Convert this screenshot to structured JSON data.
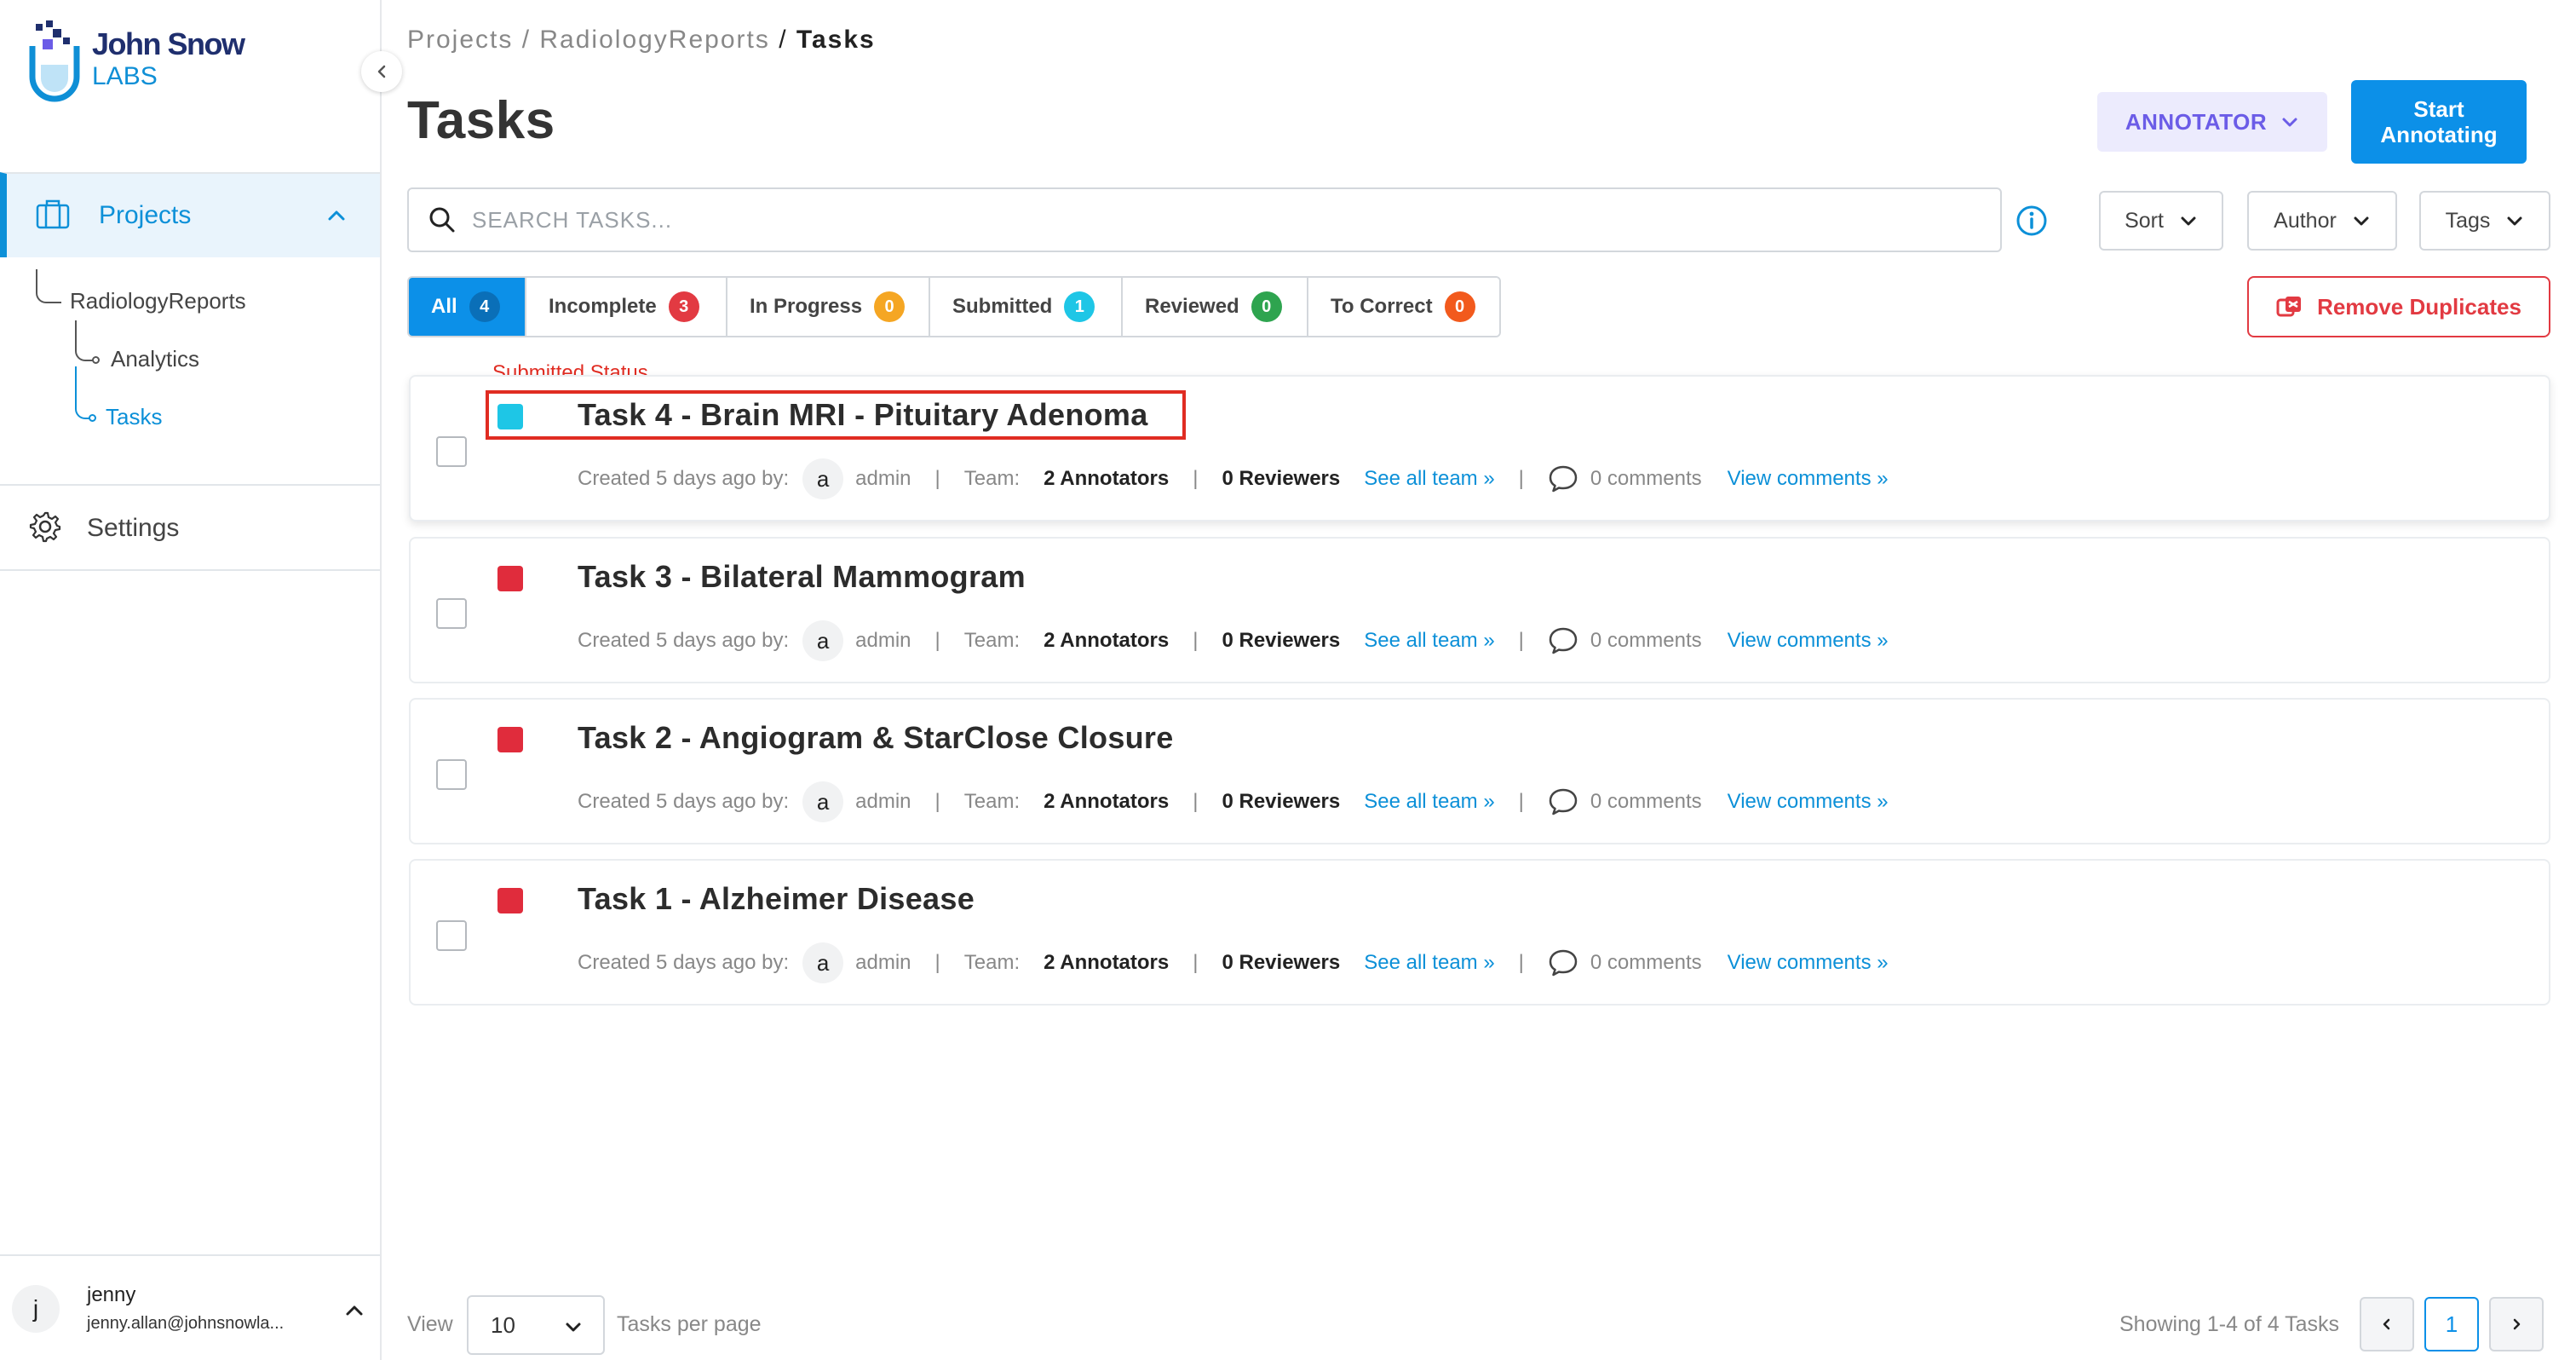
{
  "brand": {
    "name_line1": "John Snow",
    "name_line2": "LABS"
  },
  "sidebar": {
    "projects_label": "Projects",
    "tree": {
      "project": "RadiologyReports",
      "analytics": "Analytics",
      "tasks": "Tasks"
    },
    "settings_label": "Settings",
    "user": {
      "initial": "j",
      "name": "jenny",
      "email": "jenny.allan@johnsnowla..."
    }
  },
  "breadcrumb": {
    "item1": "Projects",
    "sep1": " / ",
    "item2": "RadiologyReports",
    "sep2": " / ",
    "current": "Tasks"
  },
  "page_title": "Tasks",
  "header": {
    "role_label": "ANNOTATOR",
    "start_line1": "Start",
    "start_line2": "Annotating"
  },
  "search": {
    "placeholder": "SEARCH TASKS..."
  },
  "filters": {
    "sort": "Sort",
    "author": "Author",
    "tags": "Tags"
  },
  "tabs": [
    {
      "label": "All",
      "count": "4",
      "color": "#0c90e8"
    },
    {
      "label": "Incomplete",
      "count": "3",
      "color": "#e23a42"
    },
    {
      "label": "In Progress",
      "count": "0",
      "color": "#f5a623"
    },
    {
      "label": "Submitted",
      "count": "1",
      "color": "#1ec6e6"
    },
    {
      "label": "Reviewed",
      "count": "0",
      "color": "#2ea44f"
    },
    {
      "label": "To Correct",
      "count": "0",
      "color": "#f25a1d"
    }
  ],
  "remove_duplicates": "Remove Duplicates",
  "annotation": {
    "label": "Submitted Status"
  },
  "meta_labels": {
    "created": "Created 5 days ago by:",
    "team": "Team:",
    "see_all_team": "See all team »",
    "view_comments": "View comments »",
    "sep": "|"
  },
  "tasks": [
    {
      "title": "Task 4 - Brain MRI - Pituitary Adenoma",
      "status_color": "#1ec6e6",
      "author_initial": "a",
      "author": "admin",
      "annotators": "2 Annotators",
      "reviewers": "0 Reviewers",
      "comments": "0 comments"
    },
    {
      "title": "Task 3 - Bilateral Mammogram",
      "status_color": "#e02c3c",
      "author_initial": "a",
      "author": "admin",
      "annotators": "2 Annotators",
      "reviewers": "0 Reviewers",
      "comments": "0 comments"
    },
    {
      "title": "Task 2 - Angiogram & StarClose Closure",
      "status_color": "#e02c3c",
      "author_initial": "a",
      "author": "admin",
      "annotators": "2 Annotators",
      "reviewers": "0 Reviewers",
      "comments": "0 comments"
    },
    {
      "title": "Task 1 - Alzheimer Disease",
      "status_color": "#e02c3c",
      "author_initial": "a",
      "author": "admin",
      "annotators": "2 Annotators",
      "reviewers": "0 Reviewers",
      "comments": "0 comments"
    }
  ],
  "footer": {
    "view": "View",
    "per_page_value": "10",
    "tasks_per_page": "Tasks per page",
    "showing": "Showing 1-4 of 4 Tasks",
    "current_page": "1"
  }
}
